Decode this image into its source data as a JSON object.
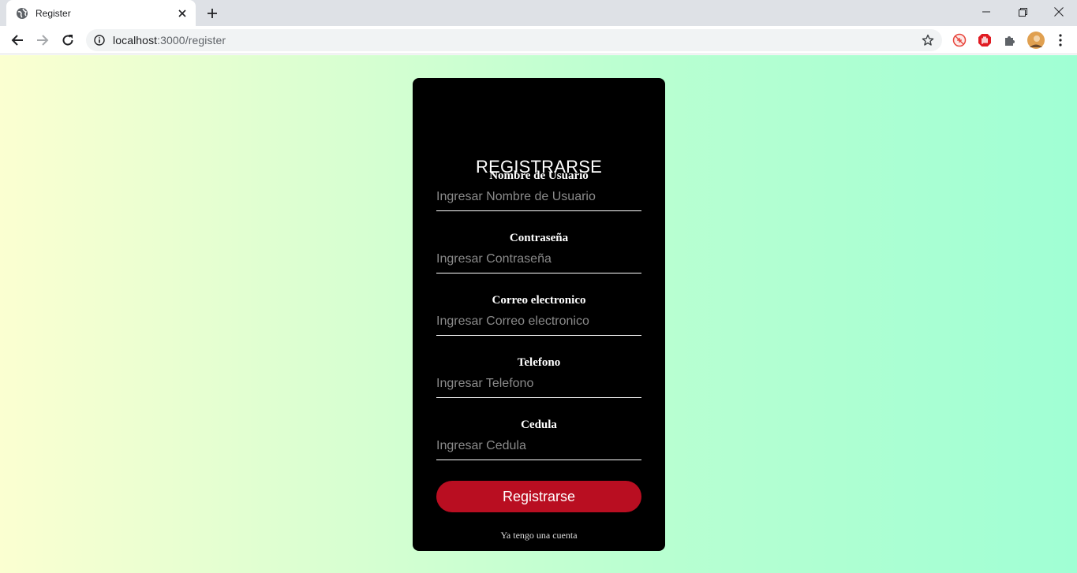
{
  "browser": {
    "tab_title": "Register",
    "url_host": "localhost",
    "url_port": ":3000",
    "url_path": "/register",
    "icons": {
      "favicon": "globe-icon",
      "tab_close": "close-icon",
      "new_tab": "plus-icon",
      "back": "arrow-left-icon",
      "forward": "arrow-right-icon",
      "reload": "reload-icon",
      "site_info": "info-icon",
      "bookmark": "star-icon",
      "extensions": "puzzle-icon",
      "menu": "kebab-menu-icon"
    },
    "window_controls": [
      "minimize",
      "restore",
      "close"
    ]
  },
  "page": {
    "background_colors": [
      "#fbffd1",
      "#a0ffd4"
    ],
    "form": {
      "title": "REGISTRARSE",
      "fields": [
        {
          "label": "Nombre de Usuario",
          "placeholder": "Ingresar Nombre de Usuario",
          "value": ""
        },
        {
          "label": "Contraseña",
          "placeholder": "Ingresar Contraseña",
          "value": ""
        },
        {
          "label": "Correo electronico",
          "placeholder": "Ingresar Correo electronico",
          "value": ""
        },
        {
          "label": "Telefono",
          "placeholder": "Ingresar Telefono",
          "value": ""
        },
        {
          "label": "Cedula",
          "placeholder": "Ingresar Cedula",
          "value": ""
        }
      ],
      "submit_label": "Registrarse",
      "submit_color": "#b90e21",
      "login_link": "Ya tengo una cuenta"
    }
  }
}
